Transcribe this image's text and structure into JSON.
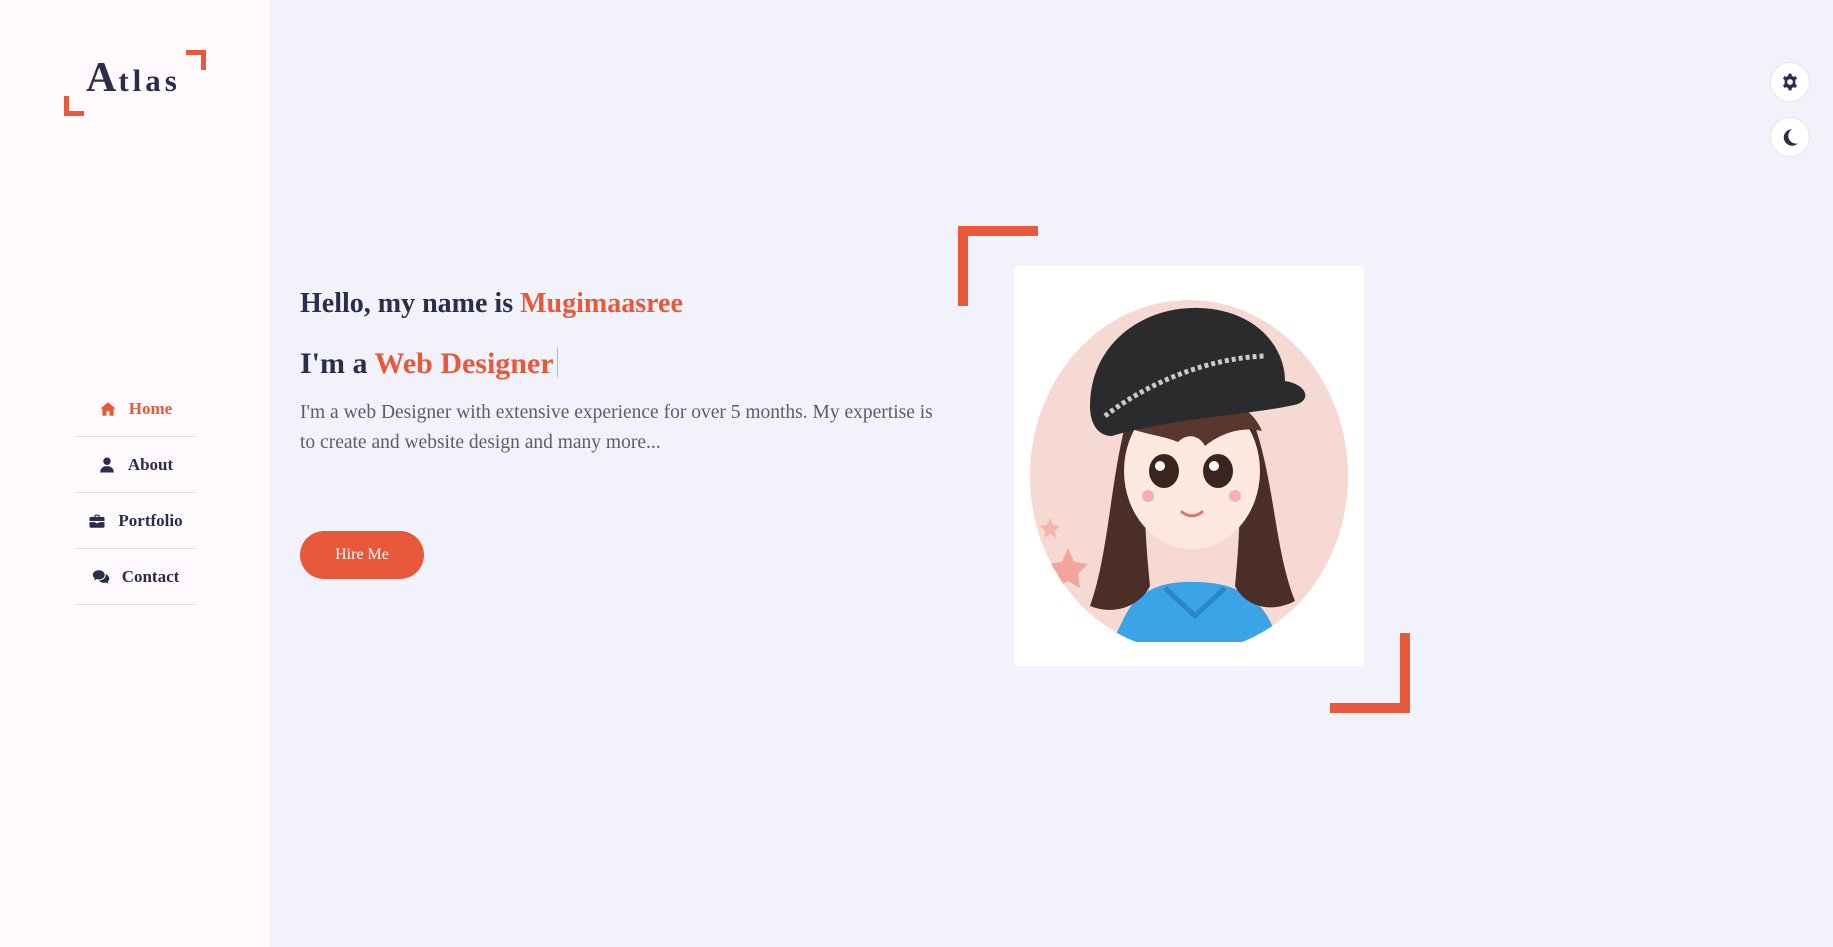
{
  "logo": {
    "initial": "A",
    "rest": "tlas"
  },
  "nav": {
    "items": [
      {
        "label": "Home",
        "icon": "home-icon",
        "active": true
      },
      {
        "label": "About",
        "icon": "user-icon",
        "active": false
      },
      {
        "label": "Portfolio",
        "icon": "briefcase-icon",
        "active": false
      },
      {
        "label": "Contact",
        "icon": "comments-icon",
        "active": false
      }
    ]
  },
  "controls": {
    "settings_icon": "gear-icon",
    "theme_icon": "moon-icon"
  },
  "hero": {
    "greeting_prefix": "Hello, my name is ",
    "name": "Mugimaasree",
    "role_prefix": "I'm a ",
    "role": "Web Designer",
    "description": "I'm a web Designer with extensive experience for over 5 months. My expertise is to create and website design and many more...",
    "cta_label": "Hire Me"
  },
  "colors": {
    "accent": "#e8583a",
    "text_dark": "#2b2d4a",
    "background": "#f2f3fa",
    "sidebar_bg": "#fdf9fd"
  }
}
